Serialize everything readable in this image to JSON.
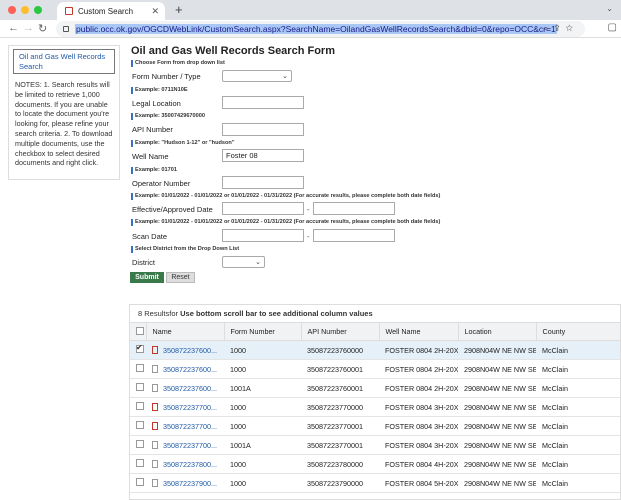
{
  "browser": {
    "tab_title": "Custom Search",
    "url": "public.occ.ok.gov/OGCDWebLink/CustomSearch.aspx?SearchName=OilandGasWellRecordsSearch&dbid=0&repo=OCC&cr=1"
  },
  "sidebar": {
    "title": "Oil and Gas Well Records Search",
    "notes": "NOTES: 1. Search results will be limited to retrieve 1,000 documents. If you are unable to locate the document you're looking for, please refine your search criteria. 2. To download multiple documents, use the checkbox to select desired documents and right click."
  },
  "form": {
    "title": "Oil and Gas Well Records Search Form",
    "hint_form": "Choose Form from drop down list",
    "form_number_label": "Form Number / Type",
    "hint_legal": "Example: 0711N10E",
    "legal_label": "Legal Location",
    "hint_api": "Example: 35007429670000",
    "api_label": "API Number",
    "hint_well": "Example: \"Hudson 1-12\" or \"hudson\"",
    "well_label": "Well Name",
    "well_value": "Foster 08",
    "hint_operator": "Example: 01701",
    "operator_label": "Operator Number",
    "hint_effective": "Example: 01/01/2022 - 01/01/2022 or 01/01/2022 - 01/31/2022 (For accurate results, please complete both date fields)",
    "effective_label": "Effective/Approved Date",
    "hint_scan": "Example: 01/01/2022 - 01/01/2022 or 01/01/2022 - 01/31/2022 (For accurate results, please complete both date fields)",
    "scan_label": "Scan Date",
    "hint_district": "Select District from the Drop Down List",
    "district_label": "District",
    "dash": "-",
    "submit_label": "Submit",
    "reset_label": "Reset"
  },
  "results": {
    "count": "8 Results",
    "for_text": "for ",
    "hint": "Use bottom scroll bar to see additional column values",
    "columns": [
      "Name",
      "Form Number",
      "API Number",
      "Well Name",
      "Location",
      "County"
    ],
    "rows": [
      {
        "name": "350872237600...",
        "form": "1000",
        "api": "35087223760000",
        "well": "FOSTER 0804 2H-20X",
        "location": "2908N04W NE NW SE SW",
        "county": "McClain"
      },
      {
        "name": "350872237600...",
        "form": "1000",
        "api": "35087223760001",
        "well": "FOSTER 0804 2H-20X",
        "location": "2908N04W NE NW SE SW",
        "county": "McClain"
      },
      {
        "name": "350872237600...",
        "form": "1001A",
        "api": "35087223760001",
        "well": "FOSTER 0804 2H-20X",
        "location": "2908N04W NE NW SE SW",
        "county": "McClain"
      },
      {
        "name": "350872237700...",
        "form": "1000",
        "api": "35087223770000",
        "well": "FOSTER 0804 3H-20X",
        "location": "2908N04W NE NW SE SW",
        "county": "McClain"
      },
      {
        "name": "350872237700...",
        "form": "1000",
        "api": "35087223770001",
        "well": "FOSTER 0804 3H-20X",
        "location": "2908N04W NE NW SE SW",
        "county": "McClain"
      },
      {
        "name": "350872237700...",
        "form": "1001A",
        "api": "35087223770001",
        "well": "FOSTER 0804 3H-20X",
        "location": "2908N04W NE NW SE SW",
        "county": "McClain"
      },
      {
        "name": "350872237800...",
        "form": "1000",
        "api": "35087223780000",
        "well": "FOSTER 0804 4H-20X",
        "location": "2908N04W NE NW SE SW",
        "county": "McClain"
      },
      {
        "name": "350872237900...",
        "form": "1000",
        "api": "35087223790000",
        "well": "FOSTER 0804 5H-20X",
        "location": "2908N04W NE NW SE SW",
        "county": "McClain"
      }
    ]
  }
}
